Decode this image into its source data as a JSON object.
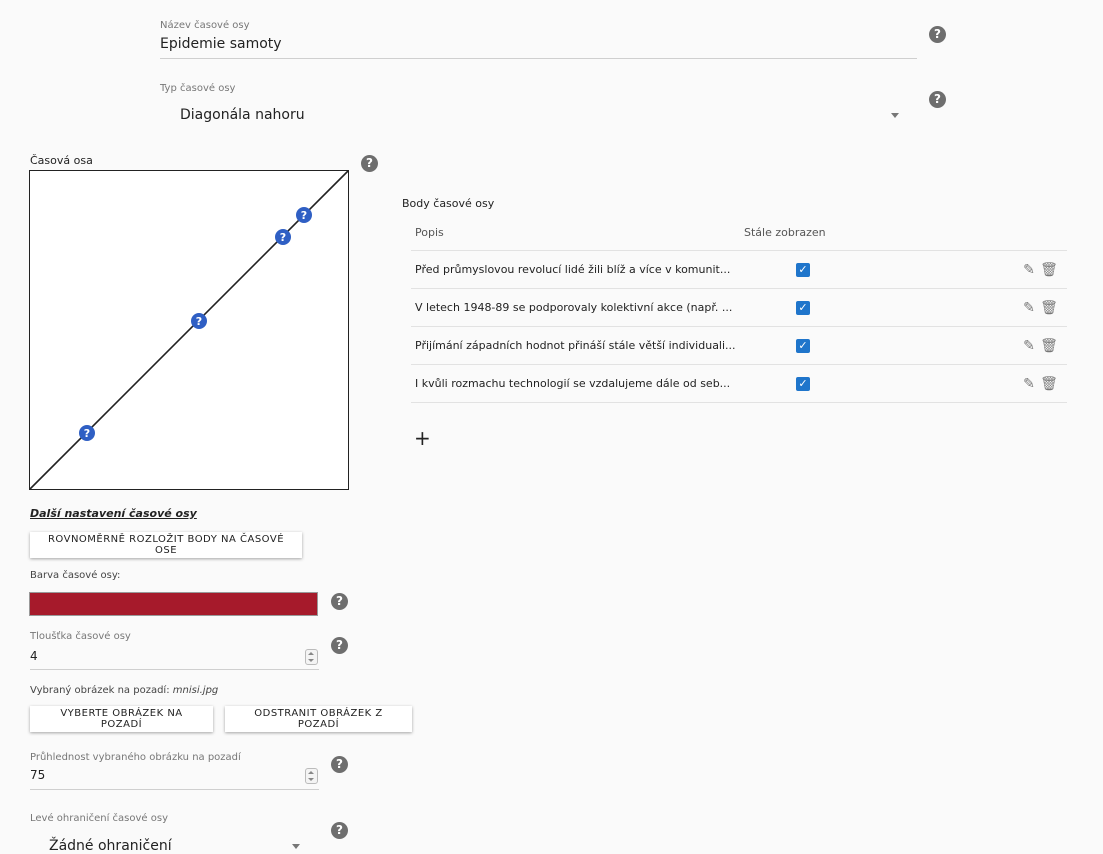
{
  "name_field": {
    "label": "Název časové osy",
    "value": "Epidemie samoty"
  },
  "type_field": {
    "label": "Typ časové osy",
    "value": "Diagonála nahoru"
  },
  "timeline_panel": {
    "title": "Časová osa",
    "marker_glyph": "?"
  },
  "points_table": {
    "title": "Body časové osy",
    "col_description": "Popis",
    "col_always_shown": "Stále zobrazen",
    "rows": [
      {
        "description": "Před průmyslovou revolucí lidé žili blíž a více v komunit...",
        "always_shown": true
      },
      {
        "description": "V letech 1948-89 se podporovaly kolektivní akce (např. ...",
        "always_shown": true
      },
      {
        "description": "Přijímání západních hodnot přináší stále větší individuali...",
        "always_shown": true
      },
      {
        "description": "I kvůli rozmachu technologií se vzdalujeme dále od seb...",
        "always_shown": true
      }
    ],
    "add_glyph": "+"
  },
  "settings": {
    "section_title": "Další nastavení časové osy",
    "distribute_button": "Rovnoměrně rozložit body na časové ose",
    "color_label": "Barva časové osy:",
    "color_value": "#a61a2b",
    "thickness_label": "Tloušťka časové osy",
    "thickness_value": "4",
    "bg_image_label": "Vybraný obrázek na pozadí:",
    "bg_image_name": "mnisi.jpg",
    "select_bg_button": "Vyberte obrázek na pozadí",
    "remove_bg_button": "Odstranit obrázek z pozadí",
    "opacity_label": "Průhlednost vybraného obrázku na pozadí",
    "opacity_value": "75",
    "left_bound_label": "Levé ohraničení časové osy",
    "left_bound_value": "Žádné ohraničení"
  },
  "help_glyph": "?",
  "colors": {
    "accent": "#1f75cb",
    "marker": "#2f5fc4",
    "help": "#6e6e6e"
  }
}
